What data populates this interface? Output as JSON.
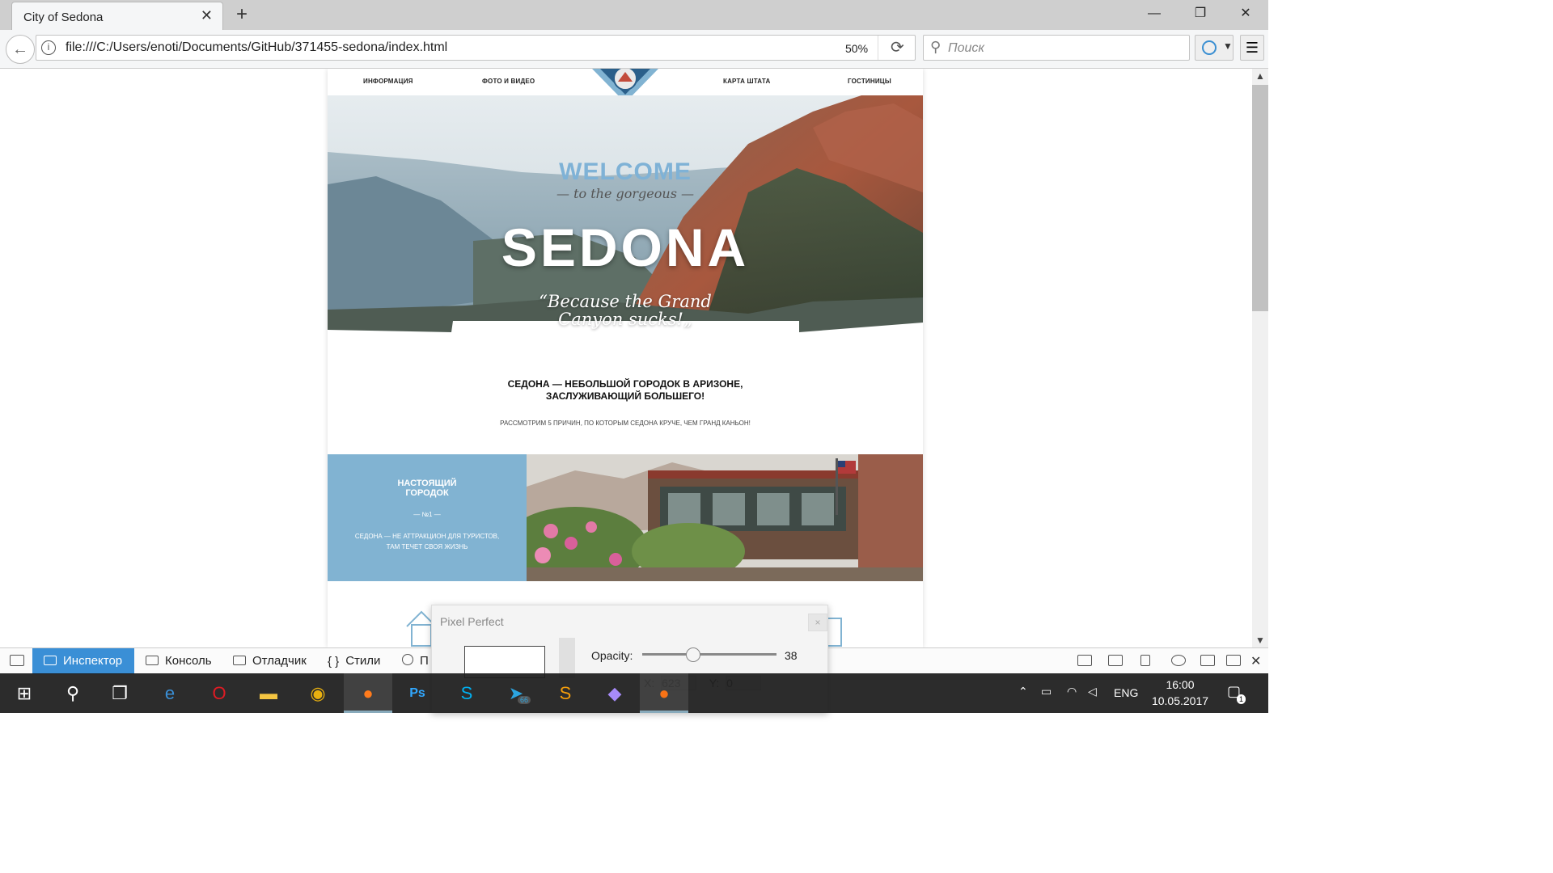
{
  "browser": {
    "tab_title": "City of Sedona",
    "tab_close": "✕",
    "new_tab": "+",
    "window_min": "—",
    "window_restore": "❐",
    "window_close": "✕",
    "url": "file:///C:/Users/enoti/Documents/GitHub/371455-sedona/index.html",
    "zoom": "50%",
    "search_placeholder": "Поиск"
  },
  "site": {
    "nav": [
      "ИНФОРМАЦИЯ",
      "ФОТО И ВИДЕО",
      "КАРТА ШТАТА",
      "ГОСТИНИЦЫ"
    ],
    "hero": {
      "welcome": "WELCOME",
      "gorgeous": "— to the gorgeous —",
      "sedona": "SEDONA",
      "quote_line1": "“Because the Grand",
      "quote_line2": "Canyon sucks!„"
    },
    "intro_line1": "СЕДОНА — НЕБОЛЬШОЙ ГОРОДОК В АРИЗОНЕ,",
    "intro_line2": "ЗАСЛУЖИВАЮЩИЙ БОЛЬШЕГО!",
    "intro_sub": "РАССМОТРИМ 5 ПРИЧИН, ПО КОТОРЫМ СЕДОНА КРУЧЕ, ЧЕМ ГРАНД КАНЬОН!",
    "feature": {
      "heading_line1": "НАСТОЯЩИЙ",
      "heading_line2": "ГОРОДОК",
      "number": "— №1 —",
      "desc_line1": "СЕДОНА — НЕ АТТРАКЦИОН ДЛЯ ТУРИСТОВ,",
      "desc_line2": "ТАМ ТЕЧЕТ СВОЯ ЖИЗНЬ"
    }
  },
  "devtools": {
    "tabs": [
      "Инспектор",
      "Консоль",
      "Отладчик",
      "Стили",
      "П"
    ]
  },
  "pixel_perfect": {
    "title": "Pixel Perfect",
    "close": "×",
    "opacity_label": "Opacity:",
    "opacity_value": "38",
    "opacity_fraction": 0.38,
    "x_label": "X:",
    "x_value": "623",
    "y_label": "Y:",
    "y_value": "0"
  },
  "taskbar": {
    "lang": "ENG",
    "time": "16:00",
    "date": "10.05.2017",
    "telegram_badge": "66",
    "notifications": "1"
  },
  "colors": {
    "accent": "#3a8fd6",
    "site_blue": "#81b3d2"
  }
}
